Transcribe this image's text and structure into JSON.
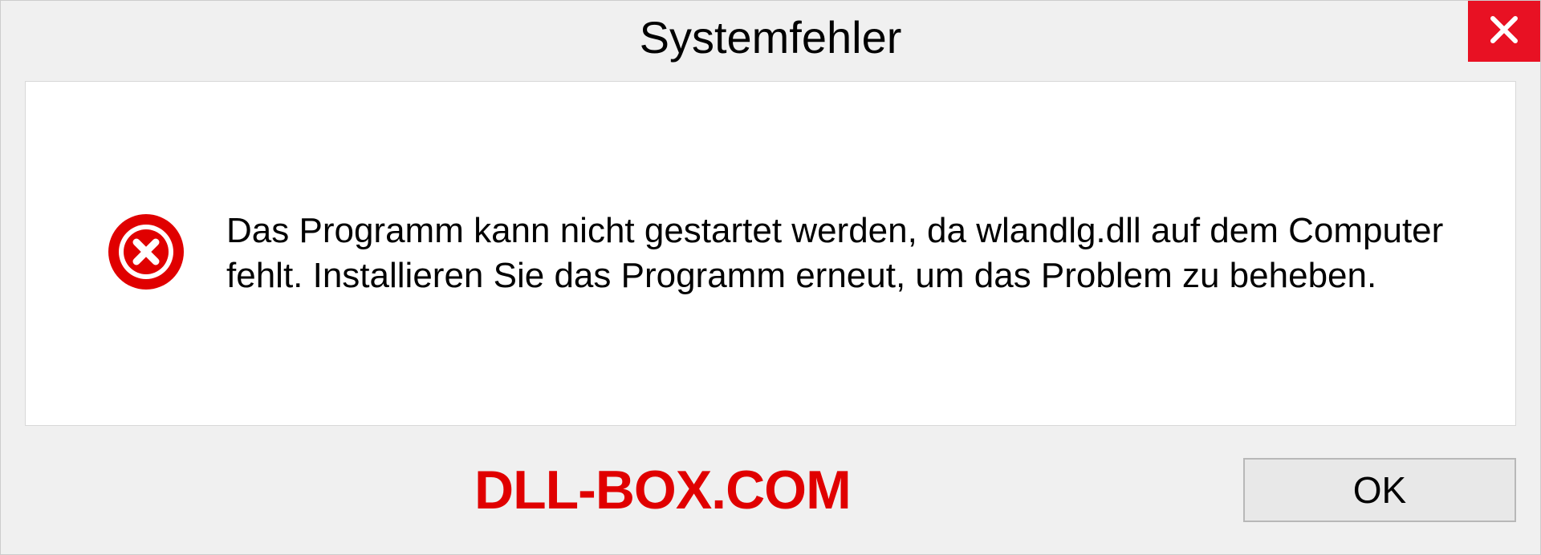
{
  "dialog": {
    "title": "Systemfehler",
    "message": "Das Programm kann nicht gestartet werden, da wlandlg.dll auf dem Computer fehlt. Installieren Sie das Programm erneut, um das Problem zu beheben.",
    "ok_label": "OK"
  },
  "watermark": "DLL-BOX.COM"
}
